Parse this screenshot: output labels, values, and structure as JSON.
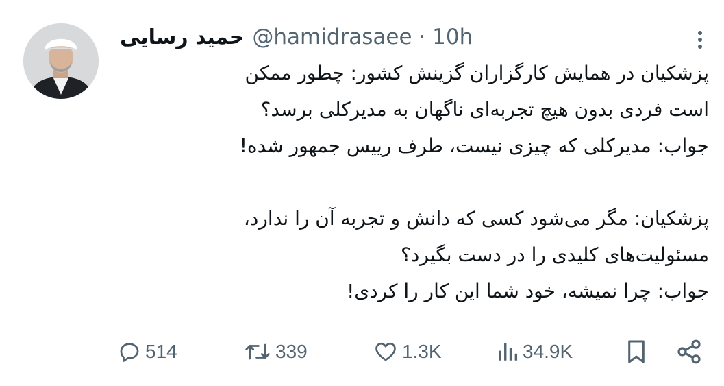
{
  "author": {
    "display_name": "حمید رسایی",
    "handle": "@hamidrasaee",
    "separator": "·",
    "time": "10h"
  },
  "tweet": {
    "lines": [
      "پزشکیان در همایش کارگزاران گزینش کشور: چطور ممکن",
      "است فردی بدون هیچ تجربه‌ای ناگهان به مدیرکلی برسد؟",
      "جواب: مدیرکلی که چیزی نیست، طرف رییس جمهور شده!",
      "",
      "پزشکیان: مگر می‌شود کسی که دانش و تجربه آن را ندارد،",
      "مسئولیت‌های کلیدی را در دست بگیرد؟",
      "جواب: چرا نمیشه، خود شما این کار را کردی!"
    ]
  },
  "actions": {
    "replies": "514",
    "reposts": "339",
    "likes": "1.3K",
    "views": "34.9K"
  },
  "icons": {
    "reply": "reply-icon",
    "repost": "repost-icon",
    "like": "heart-icon",
    "views": "views-icon",
    "bookmark": "bookmark-icon",
    "share": "share-icon",
    "more": "more-icon"
  },
  "colors": {
    "text": "#0f1419",
    "secondary": "#536471"
  }
}
